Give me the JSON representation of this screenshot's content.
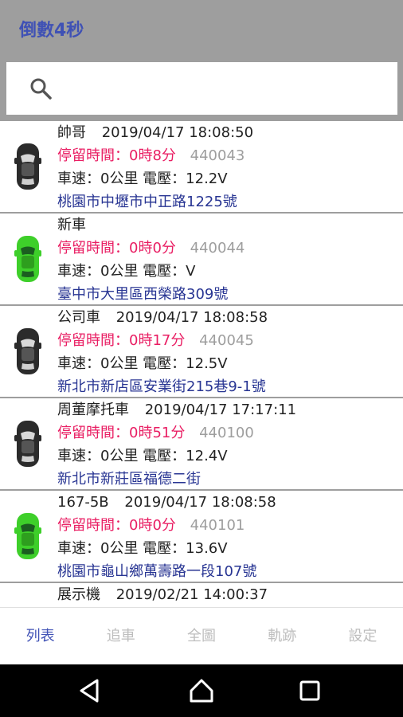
{
  "app": {
    "title": "倒數4秒"
  },
  "search": {
    "icon": "search-icon"
  },
  "vehicles": [
    {
      "name": "帥哥",
      "time": "2019/04/17 18:08:50",
      "stay": "停留時間：0時8分",
      "device_id": "440043",
      "status": "車速：0公里  電壓：12.2V",
      "address": "桃園市中壢市中正路1225號",
      "icon": "car-icon-black"
    },
    {
      "name": "新車",
      "time": "",
      "stay": "停留時間：0時0分",
      "device_id": "440044",
      "status": "車速：0公里  電壓：V",
      "address": "臺中市大里區西榮路309號",
      "icon": "car-icon-green"
    },
    {
      "name": "公司車",
      "time": "2019/04/17 18:08:58",
      "stay": "停留時間：0時17分",
      "device_id": "440045",
      "status": "車速：0公里  電壓：12.5V",
      "address": "新北市新店區安業街215巷9-1號",
      "icon": "car-icon-black"
    },
    {
      "name": "周董摩托車",
      "time": "2019/04/17 17:17:11",
      "stay": "停留時間：0時51分",
      "device_id": "440100",
      "status": "車速：0公里  電壓：12.4V",
      "address": "新北市新莊區福德二街",
      "icon": "car-icon-black"
    },
    {
      "name": "167-5B",
      "time": "2019/04/17 18:08:58",
      "stay": "停留時間：0時0分",
      "device_id": "440101",
      "status": "車速：0公里  電壓：13.6V",
      "address": "桃園市龜山鄉萬壽路一段107號",
      "icon": "car-icon-green"
    },
    {
      "name": "展示機",
      "time": "2019/02/21 14:00:37",
      "stay": "",
      "device_id": "",
      "status": "",
      "address": "",
      "icon": ""
    }
  ],
  "tabs": [
    {
      "label": "列表",
      "active": true
    },
    {
      "label": "追車",
      "active": false
    },
    {
      "label": "全圖",
      "active": false
    },
    {
      "label": "軌跡",
      "active": false
    },
    {
      "label": "設定",
      "active": false
    }
  ],
  "navbar": {
    "icons": [
      "back-icon",
      "home-icon",
      "recents-icon"
    ]
  },
  "colors": {
    "header_bg": "#9e9e9e",
    "accent": "#3f51b5",
    "stay_text": "#e91e63",
    "address_text": "#283593",
    "car_black": "#2b2b2b",
    "car_green": "#3ecf2a"
  }
}
